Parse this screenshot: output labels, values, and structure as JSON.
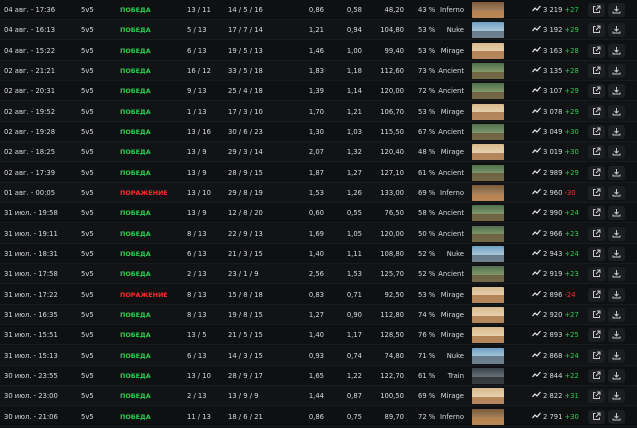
{
  "colors": {
    "win": "#2ecc4f",
    "loss": "#ff2c2c"
  },
  "icons": {
    "elo": "trend-up-icon",
    "open": "external-link-icon",
    "download": "download-icon"
  },
  "matches": [
    {
      "date": "04 авг. - 17:36",
      "mode": "5v5",
      "result": "ПОБЕДА",
      "outcome": "win",
      "score": "13 / 11",
      "kda": "14 / 5 / 16",
      "kd": "0,86",
      "kr": "0,58",
      "adr": "48,20",
      "hs": "43 %",
      "map": "Inferno",
      "elo": "3 219",
      "delta": "+27"
    },
    {
      "date": "04 авг. - 16:13",
      "mode": "5v5",
      "result": "ПОБЕДА",
      "outcome": "win",
      "score": "5 / 13",
      "kda": "17 / 7 / 14",
      "kd": "1,21",
      "kr": "0,94",
      "adr": "104,80",
      "hs": "53 %",
      "map": "Nuke",
      "elo": "3 192",
      "delta": "+29"
    },
    {
      "date": "04 авг. - 15:22",
      "mode": "5v5",
      "result": "ПОБЕДА",
      "outcome": "win",
      "score": "6 / 13",
      "kda": "19 / 5 / 13",
      "kd": "1,46",
      "kr": "1,00",
      "adr": "99,40",
      "hs": "53 %",
      "map": "Mirage",
      "elo": "3 163",
      "delta": "+28"
    },
    {
      "date": "02 авг. - 21:21",
      "mode": "5v5",
      "result": "ПОБЕДА",
      "outcome": "win",
      "score": "16 / 12",
      "kda": "33 / 5 / 18",
      "kd": "1,83",
      "kr": "1,18",
      "adr": "112,60",
      "hs": "73 %",
      "map": "Ancient",
      "elo": "3 135",
      "delta": "+28"
    },
    {
      "date": "02 авг. - 20:31",
      "mode": "5v5",
      "result": "ПОБЕДА",
      "outcome": "win",
      "score": "9 / 13",
      "kda": "25 / 4 / 18",
      "kd": "1,39",
      "kr": "1,14",
      "adr": "120,00",
      "hs": "72 %",
      "map": "Ancient",
      "elo": "3 107",
      "delta": "+29"
    },
    {
      "date": "02 авг. - 19:52",
      "mode": "5v5",
      "result": "ПОБЕДА",
      "outcome": "win",
      "score": "1 / 13",
      "kda": "17 / 3 / 10",
      "kd": "1,70",
      "kr": "1,21",
      "adr": "106,70",
      "hs": "53 %",
      "map": "Mirage",
      "elo": "3 078",
      "delta": "+29"
    },
    {
      "date": "02 авг. - 19:28",
      "mode": "5v5",
      "result": "ПОБЕДА",
      "outcome": "win",
      "score": "13 / 16",
      "kda": "30 / 6 / 23",
      "kd": "1,30",
      "kr": "1,03",
      "adr": "115,50",
      "hs": "67 %",
      "map": "Ancient",
      "elo": "3 049",
      "delta": "+30"
    },
    {
      "date": "02 авг. - 18:25",
      "mode": "5v5",
      "result": "ПОБЕДА",
      "outcome": "win",
      "score": "13 / 9",
      "kda": "29 / 3 / 14",
      "kd": "2,07",
      "kr": "1,32",
      "adr": "120,40",
      "hs": "48 %",
      "map": "Mirage",
      "elo": "3 019",
      "delta": "+30"
    },
    {
      "date": "02 авг. - 17:39",
      "mode": "5v5",
      "result": "ПОБЕДА",
      "outcome": "win",
      "score": "13 / 9",
      "kda": "28 / 9 / 15",
      "kd": "1,87",
      "kr": "1,27",
      "adr": "127,10",
      "hs": "61 %",
      "map": "Ancient",
      "elo": "2 989",
      "delta": "+29"
    },
    {
      "date": "01 авг. - 00:05",
      "mode": "5v5",
      "result": "ПОРАЖЕНИЕ",
      "outcome": "loss",
      "score": "13 / 10",
      "kda": "29 / 8 / 19",
      "kd": "1,53",
      "kr": "1,26",
      "adr": "133,00",
      "hs": "69 %",
      "map": "Inferno",
      "elo": "2 960",
      "delta": "-30"
    },
    {
      "date": "31 июл. - 19:58",
      "mode": "5v5",
      "result": "ПОБЕДА",
      "outcome": "win",
      "score": "13 / 9",
      "kda": "12 / 8 / 20",
      "kd": "0,60",
      "kr": "0,55",
      "adr": "76,50",
      "hs": "58 %",
      "map": "Ancient",
      "elo": "2 990",
      "delta": "+24"
    },
    {
      "date": "31 июл. - 19:11",
      "mode": "5v5",
      "result": "ПОБЕДА",
      "outcome": "win",
      "score": "8 / 13",
      "kda": "22 / 9 / 13",
      "kd": "1,69",
      "kr": "1,05",
      "adr": "120,00",
      "hs": "50 %",
      "map": "Ancient",
      "elo": "2 966",
      "delta": "+23"
    },
    {
      "date": "31 июл. - 18:31",
      "mode": "5v5",
      "result": "ПОБЕДА",
      "outcome": "win",
      "score": "6 / 13",
      "kda": "21 / 3 / 15",
      "kd": "1,40",
      "kr": "1,11",
      "adr": "108,80",
      "hs": "52 %",
      "map": "Nuke",
      "elo": "2 943",
      "delta": "+24"
    },
    {
      "date": "31 июл. - 17:58",
      "mode": "5v5",
      "result": "ПОБЕДА",
      "outcome": "win",
      "score": "2 / 13",
      "kda": "23 / 1 / 9",
      "kd": "2,56",
      "kr": "1,53",
      "adr": "125,70",
      "hs": "52 %",
      "map": "Ancient",
      "elo": "2 919",
      "delta": "+23"
    },
    {
      "date": "31 июл. - 17:22",
      "mode": "5v5",
      "result": "ПОРАЖЕНИЕ",
      "outcome": "loss",
      "score": "8 / 13",
      "kda": "15 / 8 / 18",
      "kd": "0,83",
      "kr": "0,71",
      "adr": "92,50",
      "hs": "53 %",
      "map": "Mirage",
      "elo": "2 896",
      "delta": "-24"
    },
    {
      "date": "31 июл. - 16:35",
      "mode": "5v5",
      "result": "ПОБЕДА",
      "outcome": "win",
      "score": "8 / 13",
      "kda": "19 / 8 / 15",
      "kd": "1,27",
      "kr": "0,90",
      "adr": "112,80",
      "hs": "74 %",
      "map": "Mirage",
      "elo": "2 920",
      "delta": "+27"
    },
    {
      "date": "31 июл. - 15:51",
      "mode": "5v5",
      "result": "ПОБЕДА",
      "outcome": "win",
      "score": "13 / 5",
      "kda": "21 / 5 / 15",
      "kd": "1,40",
      "kr": "1,17",
      "adr": "128,50",
      "hs": "76 %",
      "map": "Mirage",
      "elo": "2 893",
      "delta": "+25"
    },
    {
      "date": "31 июл. - 15:13",
      "mode": "5v5",
      "result": "ПОБЕДА",
      "outcome": "win",
      "score": "6 / 13",
      "kda": "14 / 3 / 15",
      "kd": "0,93",
      "kr": "0,74",
      "adr": "74,80",
      "hs": "71 %",
      "map": "Nuke",
      "elo": "2 868",
      "delta": "+24"
    },
    {
      "date": "30 июл. - 23:55",
      "mode": "5v5",
      "result": "ПОБЕДА",
      "outcome": "win",
      "score": "13 / 10",
      "kda": "28 / 9 / 17",
      "kd": "1,65",
      "kr": "1,22",
      "adr": "122,70",
      "hs": "61 %",
      "map": "Train",
      "elo": "2 844",
      "delta": "+22"
    },
    {
      "date": "30 июл. - 23:00",
      "mode": "5v5",
      "result": "ПОБЕДА",
      "outcome": "win",
      "score": "2 / 13",
      "kda": "13 / 9 / 9",
      "kd": "1,44",
      "kr": "0,87",
      "adr": "100,50",
      "hs": "69 %",
      "map": "Mirage",
      "elo": "2 822",
      "delta": "+31"
    },
    {
      "date": "30 июл. - 21:06",
      "mode": "5v5",
      "result": "ПОБЕДА",
      "outcome": "win",
      "score": "11 / 13",
      "kda": "18 / 6 / 21",
      "kd": "0,86",
      "kr": "0,75",
      "adr": "89,70",
      "hs": "72 %",
      "map": "Inferno",
      "elo": "2 791",
      "delta": "+30"
    }
  ]
}
